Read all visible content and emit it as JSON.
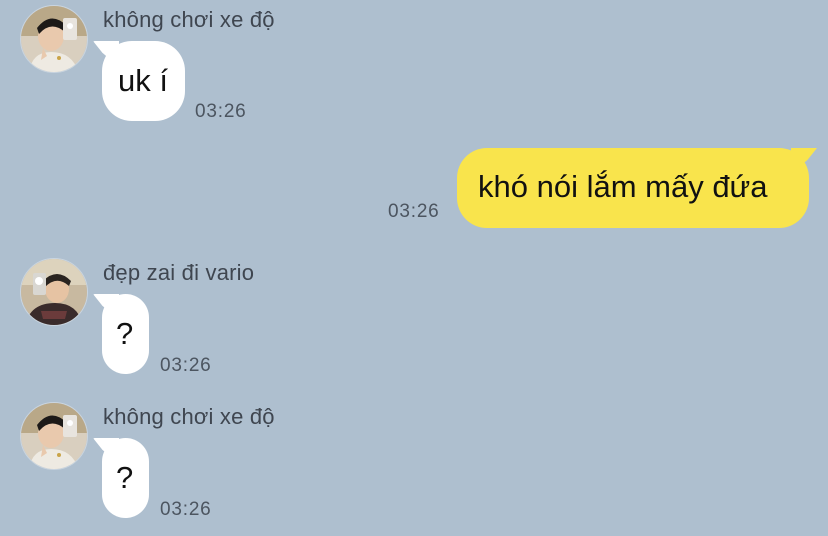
{
  "messages": [
    {
      "sender": "không chơi xe độ",
      "avatar": "avatar-boy-peace-sign",
      "text": "uk í",
      "time": "03:26",
      "direction": "incoming"
    },
    {
      "text": "khó nói lắm mấy đứa",
      "time": "03:26",
      "direction": "outgoing"
    },
    {
      "sender": "đẹp zai đi vario",
      "avatar": "avatar-boy-mirror-selfie",
      "text": "?",
      "time": "03:26",
      "direction": "incoming"
    },
    {
      "sender": "không chơi xe độ",
      "avatar": "avatar-boy-peace-sign",
      "text": "?",
      "time": "03:26",
      "direction": "incoming"
    }
  ],
  "colors": {
    "background": "#aebfcf",
    "incoming_bubble": "#ffffff",
    "outgoing_bubble": "#f9e44c",
    "sender_text": "#3f4650",
    "time_text": "#4c5560"
  }
}
